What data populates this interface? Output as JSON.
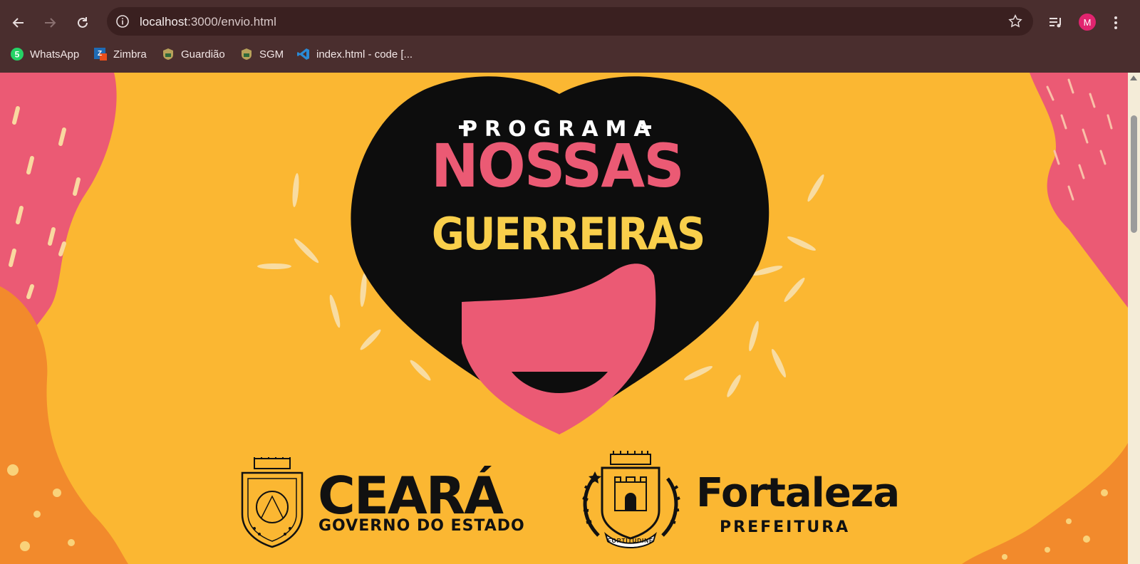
{
  "browser": {
    "url_host": "localhost",
    "url_path": ":3000/envio.html",
    "avatar_letter": "M",
    "bookmarks": [
      {
        "label": "WhatsApp",
        "icon": "whatsapp-icon",
        "badge": "5"
      },
      {
        "label": "Zimbra",
        "icon": "zimbra-icon"
      },
      {
        "label": "Guardião",
        "icon": "guardiao-icon"
      },
      {
        "label": "SGM",
        "icon": "sgm-icon"
      },
      {
        "label": "index.html - code [...",
        "icon": "vscode-icon"
      }
    ],
    "colors": {
      "chrome": "#4a2e2e",
      "omnibox": "#3a2020",
      "avatar": "#e1246f"
    }
  },
  "hero": {
    "program_label": "PROGRAMA",
    "title_line1": "NOSSAS",
    "title_line2": "GUERREIRAS",
    "colors": {
      "background": "#fbb732",
      "pink": "#eb5a74",
      "orange": "#f28a2c",
      "yellow_text": "#f9cf4b",
      "black": "#0d0d0d"
    }
  },
  "logos": {
    "ceara_name": "CEARÁ",
    "ceara_sub": "GOVERNO DO ESTADO",
    "fortaleza_name": "Fortaleza",
    "fortaleza_sub": "PREFEITURA",
    "fortaleza_motto": "FORTITUDINE"
  }
}
